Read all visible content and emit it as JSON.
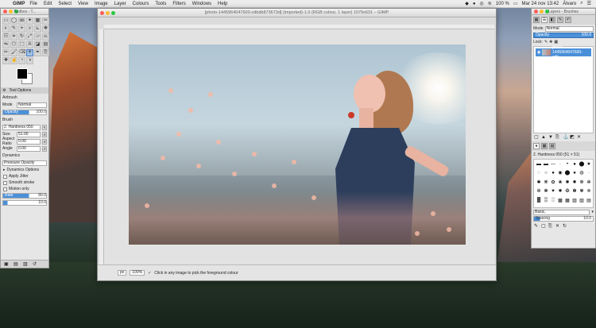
{
  "menubar": {
    "app": "GIMP",
    "menus": [
      "File",
      "Edit",
      "Select",
      "View",
      "Image",
      "Layer",
      "Colours",
      "Tools",
      "Filters",
      "Windows",
      "Help"
    ],
    "battery": "100 %",
    "datetime": "Mar 24 nov 13:42",
    "user": "Álvaro"
  },
  "toolbox": {
    "title": "Toolbox - T...",
    "tool_options_tab": "Tool Options",
    "tool_name": "Airbrush",
    "mode_label": "Mode",
    "mode_value": "Normal",
    "opacity_label": "Opacity",
    "opacity_value": "100.0",
    "brush_label": "Brush",
    "brush_value": "2. Hardness 050",
    "size_label": "Size",
    "size_value": "51.00",
    "aspect_label": "Aspect Ratio",
    "aspect_value": "0.00",
    "angle_label": "Angle",
    "angle_value": "0.00",
    "dynamics_label": "Dynamics",
    "dynamics_value": "Pressure Opacity",
    "dynamics_options": "Dynamics Options",
    "apply_jitter": "Apply Jitter",
    "smooth_stroke": "Smooth stroke",
    "motion_only": "Motion only",
    "rate_label": "Rate",
    "rate_value": "80.0",
    "flow_value": "10.0"
  },
  "image_window": {
    "title": "[photo-1445964047600-cdbdb873673d] (imported)-1.0 (RGB colour, 1 layer) 1079x631 – GIMP",
    "menu": [
      "File",
      "Edit",
      "Select",
      "View",
      "Image",
      "Layer",
      "Colours",
      "Tools",
      "Filters",
      "Windows",
      "Help"
    ],
    "unit": "px",
    "zoom": "100%",
    "status_text": "Click in any image to pick the foreground colour"
  },
  "dock": {
    "title": "Layers - Brushes",
    "mode_label": "Mode",
    "mode_value": "Normal",
    "opacity_label": "Opacity",
    "opacity_value": "100.0",
    "lock_label": "Lock:",
    "layer_name": "photo-1445964047600-cdb...",
    "brush_name": "2. Hardness 050 (51 × 51)",
    "brush_tag_placeholder": "Basic,",
    "spacing_label": "Spacing",
    "spacing_value": "10.0"
  },
  "colors": {
    "foreground": "#000000",
    "background": "#ffffff",
    "selection": "#4a90d9"
  }
}
